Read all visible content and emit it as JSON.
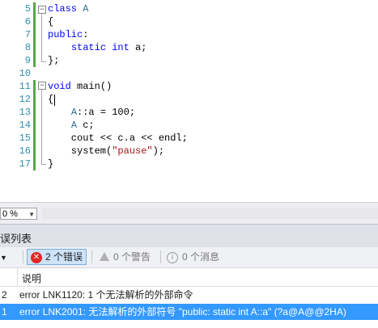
{
  "editor": {
    "lines": [
      {
        "n": "5",
        "parts": [
          {
            "c": "kw",
            "t": "class"
          },
          {
            "c": "ctext",
            "t": " "
          },
          {
            "c": "id",
            "t": "A"
          }
        ]
      },
      {
        "n": "6",
        "parts": [
          {
            "c": "ctext",
            "t": "{"
          }
        ]
      },
      {
        "n": "7",
        "parts": [
          {
            "c": "kw",
            "t": "public"
          },
          {
            "c": "ctext",
            "t": ":"
          }
        ]
      },
      {
        "n": "8",
        "parts": [
          {
            "c": "ctext",
            "t": "    "
          },
          {
            "c": "kw",
            "t": "static"
          },
          {
            "c": "ctext",
            "t": " "
          },
          {
            "c": "kw",
            "t": "int"
          },
          {
            "c": "ctext",
            "t": " a;"
          }
        ]
      },
      {
        "n": "9",
        "parts": [
          {
            "c": "ctext",
            "t": "};"
          }
        ]
      },
      {
        "n": "10",
        "parts": []
      },
      {
        "n": "11",
        "parts": [
          {
            "c": "kw",
            "t": "void"
          },
          {
            "c": "ctext",
            "t": " main()"
          }
        ]
      },
      {
        "n": "12",
        "parts": [
          {
            "c": "ctext",
            "t": "{"
          }
        ]
      },
      {
        "n": "13",
        "parts": [
          {
            "c": "ctext",
            "t": "    "
          },
          {
            "c": "id",
            "t": "A"
          },
          {
            "c": "ctext",
            "t": "::a = 100;"
          }
        ]
      },
      {
        "n": "14",
        "parts": [
          {
            "c": "ctext",
            "t": "    "
          },
          {
            "c": "id",
            "t": "A"
          },
          {
            "c": "ctext",
            "t": " c;"
          }
        ]
      },
      {
        "n": "15",
        "parts": [
          {
            "c": "ctext",
            "t": "    cout << c.a << endl;"
          }
        ]
      },
      {
        "n": "16",
        "parts": [
          {
            "c": "ctext",
            "t": "    system("
          },
          {
            "c": "str",
            "t": "\"pause\""
          },
          {
            "c": "ctext",
            "t": ");"
          }
        ]
      },
      {
        "n": "17",
        "parts": [
          {
            "c": "ctext",
            "t": "}"
          }
        ]
      }
    ]
  },
  "zoom": {
    "value": "0 %"
  },
  "errorlist": {
    "title": "误列表",
    "errors_button": "2 个错误",
    "warnings_button": "0 个警告",
    "messages_button": "0 个消息",
    "column_description": "说明",
    "rows": [
      {
        "num": "2",
        "text": "error LNK1120: 1 个无法解析的外部命令"
      },
      {
        "num": "1",
        "text": "error LNK2001: 无法解析的外部符号 \"public: static int A::a\" (?a@A@@2HA)"
      }
    ]
  },
  "colors": {
    "keyword": "#0000ff",
    "type": "#2b6d96",
    "string": "#a31515",
    "linenum": "#2b91af",
    "gutter_change": "#57a64a",
    "selection": "#3399ff"
  }
}
